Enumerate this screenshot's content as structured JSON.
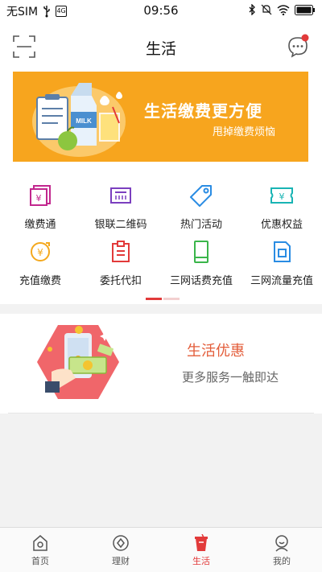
{
  "status_bar": {
    "carrier": "无SIM",
    "time": "09:56",
    "battery_badge": "4G"
  },
  "nav": {
    "title": "生活"
  },
  "banner": {
    "title": "生活缴费更方便",
    "subtitle": "甩掉缴费烦恼",
    "carton_text": "MILK",
    "bg_color": "#f7a51e"
  },
  "grid": {
    "items": [
      {
        "label": "缴费通",
        "icon": "bill-icon",
        "color": "#c2278e"
      },
      {
        "label": "银联二维码",
        "icon": "unionpay-qr-icon",
        "color": "#7b3fbf"
      },
      {
        "label": "热门活动",
        "icon": "tag-icon",
        "color": "#2a8ce3"
      },
      {
        "label": "优惠权益",
        "icon": "coupon-icon",
        "color": "#19b4b4"
      },
      {
        "label": "充值缴费",
        "icon": "recharge-coin-icon",
        "color": "#f4a81d"
      },
      {
        "label": "委托代扣",
        "icon": "clipboard-icon",
        "color": "#e23a3a"
      },
      {
        "label": "三网话费充值",
        "icon": "phone-icon",
        "color": "#3ab54a"
      },
      {
        "label": "三网流量充值",
        "icon": "sim-card-icon",
        "color": "#2a8ce3"
      }
    ],
    "active_color": "#e23a3a"
  },
  "promo": {
    "title": "生活优惠",
    "subtitle": "更多服务一触即达"
  },
  "tabbar": {
    "tabs": [
      {
        "label": "首页",
        "icon": "home-icon",
        "active": false
      },
      {
        "label": "理财",
        "icon": "finance-icon",
        "active": false
      },
      {
        "label": "生活",
        "icon": "life-cup-icon",
        "active": true
      },
      {
        "label": "我的",
        "icon": "profile-icon",
        "active": false
      }
    ]
  }
}
